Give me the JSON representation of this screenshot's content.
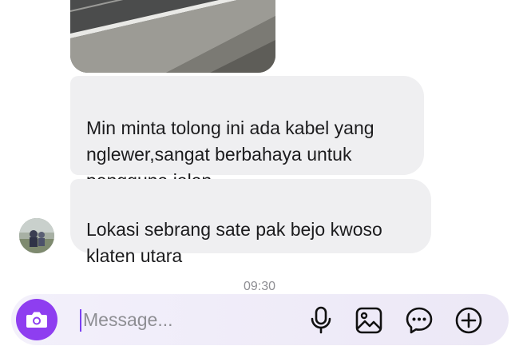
{
  "conversation": {
    "image_message": {
      "kind": "photo"
    },
    "messages": [
      {
        "text": "Min minta tolong ini ada kabel yang\nnglewer,sangat berbahaya untuk\npengguna jalan"
      },
      {
        "text": "Lokasi sebrang sate pak bejo kwoso\nklaten utara"
      }
    ],
    "timestamp": "09:30"
  },
  "composer": {
    "placeholder": "Message...",
    "value": "",
    "accent_color": "#8e3ef0",
    "icons": [
      "camera-icon",
      "microphone-icon",
      "gallery-icon",
      "sticker-icon",
      "plus-icon"
    ]
  },
  "colors": {
    "bubble": "#efeff1",
    "composer": "#f0edf8",
    "text": "#1c1c1e"
  }
}
